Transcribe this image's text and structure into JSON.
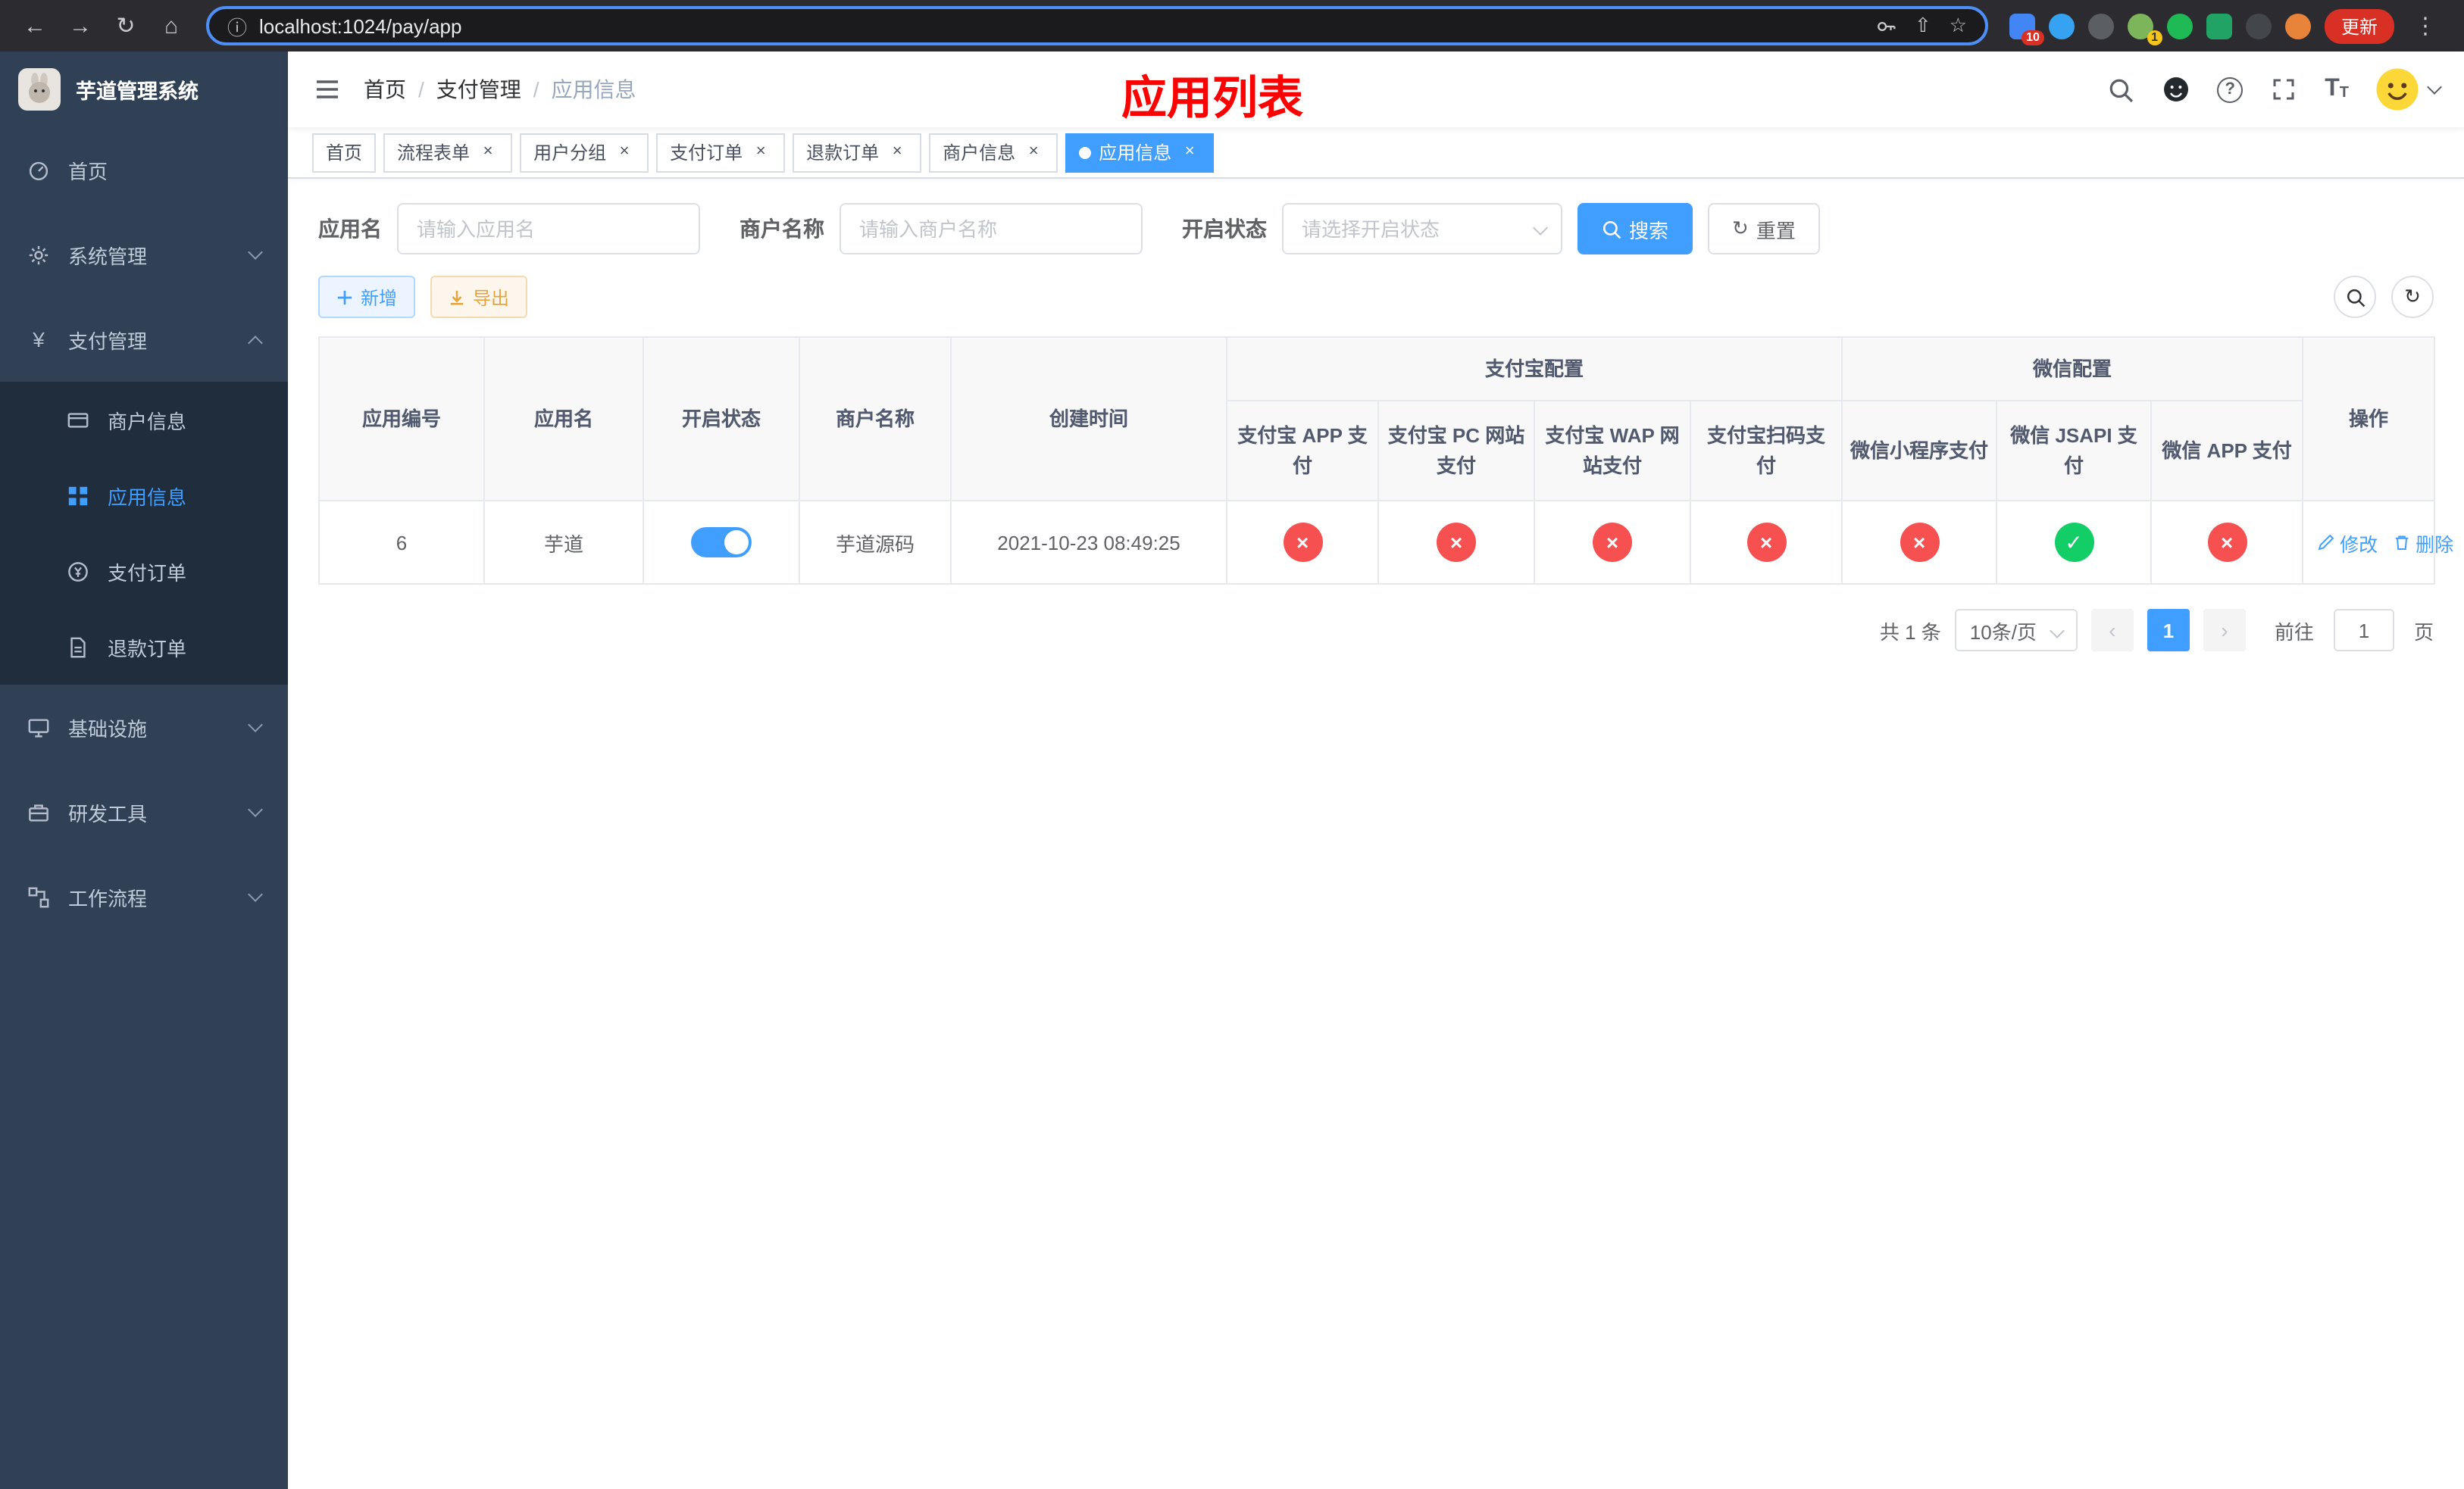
{
  "browser": {
    "url": "localhost:1024/pay/app",
    "update_label": "更新",
    "badges": [
      "10",
      "1"
    ]
  },
  "icons": {
    "back": "←",
    "forward": "→",
    "reload": "↻",
    "home": "⌂",
    "info": "ⓘ",
    "share": "⇧",
    "star": "☆",
    "menu_dots": "⋮",
    "close": "×",
    "yen": "¥",
    "check": "✓",
    "cross": "×",
    "prev": "‹",
    "next": "›",
    "question": "?",
    "text_size_big": "T",
    "text_size_small": "T"
  },
  "sidebar": {
    "title": "芋道管理系统",
    "items": [
      {
        "label": "首页"
      },
      {
        "label": "系统管理"
      },
      {
        "label": "支付管理",
        "children": [
          {
            "label": "商户信息"
          },
          {
            "label": "应用信息"
          },
          {
            "label": "支付订单"
          },
          {
            "label": "退款订单"
          }
        ]
      },
      {
        "label": "基础设施"
      },
      {
        "label": "研发工具"
      },
      {
        "label": "工作流程"
      }
    ]
  },
  "header": {
    "breadcrumb": [
      "首页",
      "支付管理",
      "应用信息"
    ],
    "separator": "/",
    "overlay_title": "应用列表"
  },
  "tabs": [
    {
      "label": "首页"
    },
    {
      "label": "流程表单"
    },
    {
      "label": "用户分组"
    },
    {
      "label": "支付订单"
    },
    {
      "label": "退款订单"
    },
    {
      "label": "商户信息"
    },
    {
      "label": "应用信息"
    }
  ],
  "filters": {
    "app_name_label": "应用名",
    "app_name_placeholder": "请输入应用名",
    "merchant_label": "商户名称",
    "merchant_placeholder": "请输入商户名称",
    "status_label": "开启状态",
    "status_placeholder": "请选择开启状态",
    "search_button": "搜索",
    "reset_button": "重置"
  },
  "toolbar": {
    "add_button": "新增",
    "export_button": "导出"
  },
  "table": {
    "simple_columns": [
      "应用编号",
      "应用名",
      "开启状态",
      "商户名称",
      "创建时间"
    ],
    "alipay_group": "支付宝配置",
    "alipay_columns": [
      "支付宝 APP 支付",
      "支付宝 PC 网站支付",
      "支付宝 WAP 网站支付",
      "支付宝扫码支付"
    ],
    "wechat_group": "微信配置",
    "wechat_columns": [
      "微信小程序支付",
      "微信 JSAPI 支付",
      "微信 APP 支付"
    ],
    "ops_column": "操作",
    "rows": [
      {
        "id": "6",
        "name": "芋道",
        "enabled": true,
        "merchant": "芋道源码",
        "created": "2021-10-23 08:49:25",
        "payments": {
          "alipay_app": false,
          "alipay_pc": false,
          "alipay_wap": false,
          "alipay_qr": false,
          "wechat_mini": false,
          "wechat_jsapi": true,
          "wechat_app": false
        },
        "edit_label": "修改",
        "delete_label": "删除"
      }
    ]
  },
  "pagination": {
    "total_text": "共 1 条",
    "page_size": "10条/页",
    "current_page": "1",
    "goto_prefix": "前往",
    "goto_value": "1",
    "goto_suffix": "页"
  },
  "colors": {
    "primary": "#409eff",
    "success": "#13ce66",
    "danger": "#f75050",
    "warning": "#e6a23c",
    "sidebar_bg": "#304156",
    "submenu_bg": "#1f2d3d",
    "overlay_title": "#ff0000"
  }
}
